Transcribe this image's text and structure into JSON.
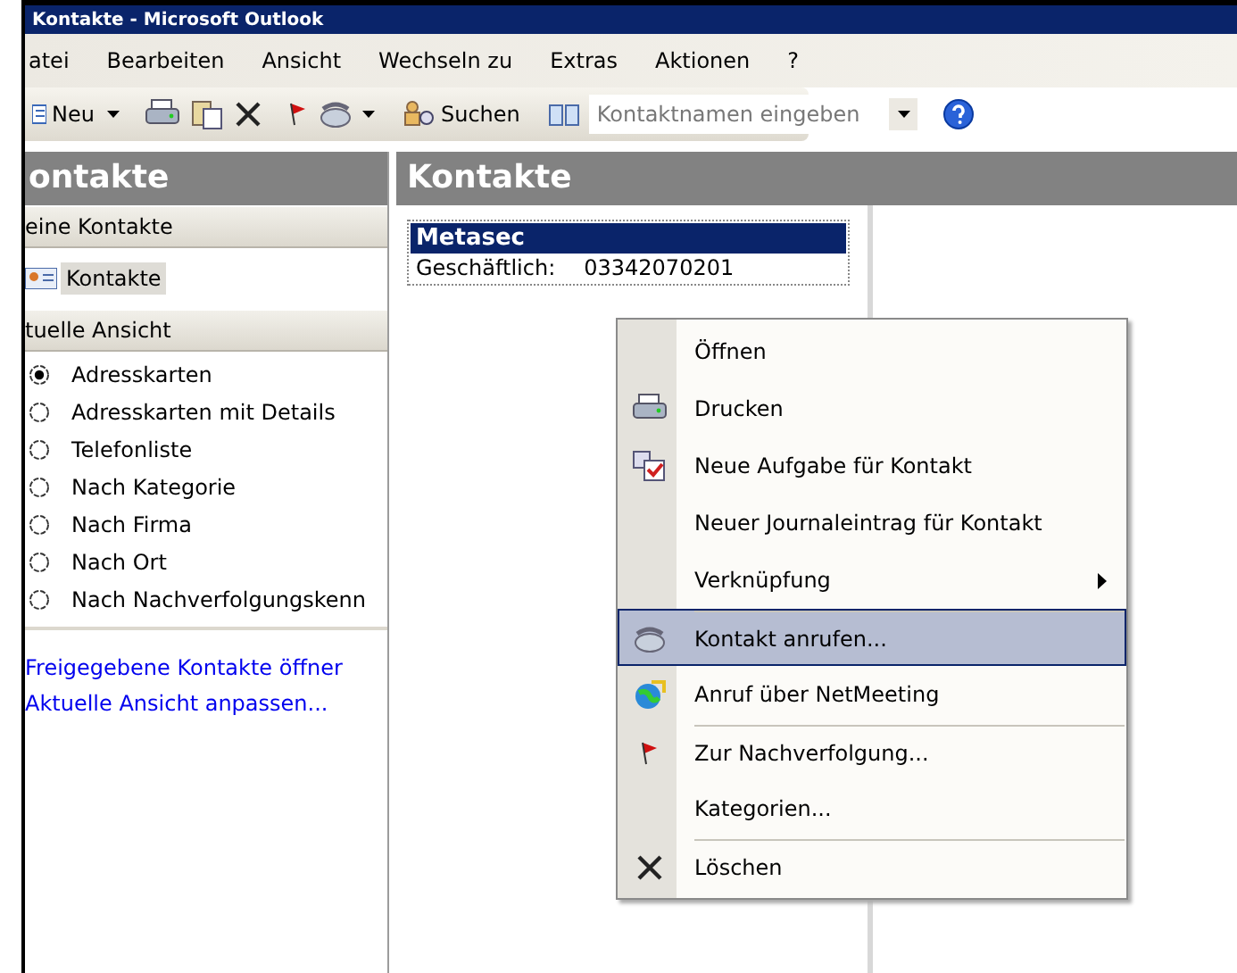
{
  "window": {
    "title": "Kontakte - Microsoft Outlook"
  },
  "menu_bar": [
    {
      "label": "atei"
    },
    {
      "label": "Bearbeiten"
    },
    {
      "label": "Ansicht"
    },
    {
      "label": "Wechseln zu"
    },
    {
      "label": "Extras"
    },
    {
      "label": "Aktionen"
    },
    {
      "label": "?"
    }
  ],
  "toolbar": {
    "new_label": "Neu",
    "search_label": "Suchen",
    "contact_field": {
      "placeholder": "Kontaktnamen eingeben"
    }
  },
  "navigation": {
    "title": "ontakte",
    "my_contacts_header": "eine Kontakte",
    "folders": [
      {
        "label": "Kontakte",
        "selected": true
      }
    ],
    "current_view_header": "tuelle Ansicht",
    "views": [
      {
        "label": "Adresskarten",
        "selected": true
      },
      {
        "label": "Adresskarten mit Details",
        "selected": false
      },
      {
        "label": "Telefonliste",
        "selected": false
      },
      {
        "label": "Nach Kategorie",
        "selected": false
      },
      {
        "label": "Nach Firma",
        "selected": false
      },
      {
        "label": "Nach Ort",
        "selected": false
      },
      {
        "label": "Nach Nachverfolgungskenn",
        "selected": false
      }
    ],
    "links": [
      {
        "label": "Freigegebene Kontakte öffner"
      },
      {
        "label": "Aktuelle Ansicht anpassen..."
      }
    ]
  },
  "content": {
    "title": "Kontakte",
    "cards": [
      {
        "name": "Metasec",
        "selected": true,
        "fields": [
          {
            "label": "Geschäftlich:",
            "value": "03342070201"
          }
        ]
      }
    ]
  },
  "context_menu": {
    "items": [
      {
        "label": "Öffnen",
        "kind": "none",
        "selected": false,
        "submenu": false,
        "separator_before": false
      },
      {
        "label": "Drucken",
        "kind": "printer",
        "selected": false,
        "submenu": false,
        "separator_before": false
      },
      {
        "label": "Neue Aufgabe für Kontakt",
        "kind": "task",
        "selected": false,
        "submenu": false,
        "separator_before": false
      },
      {
        "label": "Neuer Journaleintrag für Kontakt",
        "kind": "none",
        "selected": false,
        "submenu": false,
        "separator_before": false
      },
      {
        "label": "Verknüpfung",
        "kind": "none",
        "selected": false,
        "submenu": true,
        "separator_before": false
      },
      {
        "label": "Kontakt anrufen...",
        "kind": "phone",
        "selected": true,
        "submenu": false,
        "separator_before": true
      },
      {
        "label": "Anruf über NetMeeting",
        "kind": "globe",
        "selected": false,
        "submenu": false,
        "separator_before": false
      },
      {
        "label": "Zur Nachverfolgung...",
        "kind": "flag",
        "selected": false,
        "submenu": false,
        "separator_before": true
      },
      {
        "label": "Kategorien...",
        "kind": "none",
        "selected": false,
        "submenu": false,
        "separator_before": false
      },
      {
        "label": "Löschen",
        "kind": "delete",
        "selected": false,
        "submenu": false,
        "separator_before": true
      }
    ]
  }
}
